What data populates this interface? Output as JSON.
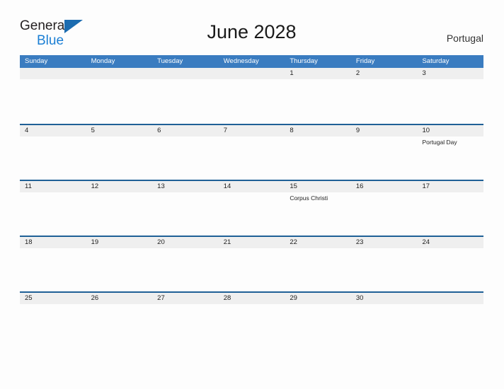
{
  "brand": {
    "word_one": "General",
    "word_two": "Blue",
    "triangle_color": "#1b6cb0",
    "word_one_color": "#231f20",
    "word_two_color": "#1b7fd4"
  },
  "header": {
    "title": "June 2028",
    "country": "Portugal"
  },
  "theme": {
    "header_blue": "#3a7cc0",
    "row_rule_blue": "#1f6096",
    "band_gray": "#efefef",
    "page_background": "#fdfdfd"
  },
  "calendar": {
    "weekday_headers": [
      "Sunday",
      "Monday",
      "Tuesday",
      "Wednesday",
      "Thursday",
      "Friday",
      "Saturday"
    ],
    "weeks": [
      [
        {
          "day": "",
          "event": ""
        },
        {
          "day": "",
          "event": ""
        },
        {
          "day": "",
          "event": ""
        },
        {
          "day": "",
          "event": ""
        },
        {
          "day": "1",
          "event": ""
        },
        {
          "day": "2",
          "event": ""
        },
        {
          "day": "3",
          "event": ""
        }
      ],
      [
        {
          "day": "4",
          "event": ""
        },
        {
          "day": "5",
          "event": ""
        },
        {
          "day": "6",
          "event": ""
        },
        {
          "day": "7",
          "event": ""
        },
        {
          "day": "8",
          "event": ""
        },
        {
          "day": "9",
          "event": ""
        },
        {
          "day": "10",
          "event": "Portugal Day"
        }
      ],
      [
        {
          "day": "11",
          "event": ""
        },
        {
          "day": "12",
          "event": ""
        },
        {
          "day": "13",
          "event": ""
        },
        {
          "day": "14",
          "event": ""
        },
        {
          "day": "15",
          "event": "Corpus Christi"
        },
        {
          "day": "16",
          "event": ""
        },
        {
          "day": "17",
          "event": ""
        }
      ],
      [
        {
          "day": "18",
          "event": ""
        },
        {
          "day": "19",
          "event": ""
        },
        {
          "day": "20",
          "event": ""
        },
        {
          "day": "21",
          "event": ""
        },
        {
          "day": "22",
          "event": ""
        },
        {
          "day": "23",
          "event": ""
        },
        {
          "day": "24",
          "event": ""
        }
      ],
      [
        {
          "day": "25",
          "event": ""
        },
        {
          "day": "26",
          "event": ""
        },
        {
          "day": "27",
          "event": ""
        },
        {
          "day": "28",
          "event": ""
        },
        {
          "day": "29",
          "event": ""
        },
        {
          "day": "30",
          "event": ""
        },
        {
          "day": "",
          "event": ""
        }
      ]
    ]
  }
}
